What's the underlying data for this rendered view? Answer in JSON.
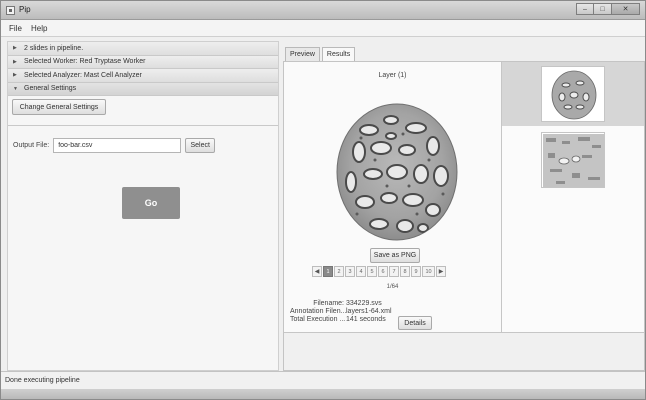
{
  "window": {
    "title": "Pip"
  },
  "menu": {
    "items": [
      "File",
      "Help"
    ]
  },
  "sidebar": {
    "sections": [
      {
        "label": "2 slides in pipeline.",
        "state": "collapsed"
      },
      {
        "label": "Selected Worker: Red Tryptase Worker",
        "state": "collapsed"
      },
      {
        "label": "Selected Analyzer: Mast Cell Analyzer",
        "state": "collapsed"
      },
      {
        "label": "General Settings",
        "state": "expanded"
      }
    ],
    "change_settings_label": "Change General Settings",
    "output_file_label": "Output File:",
    "output_file_value": "foo-bar.csv",
    "select_label": "Select",
    "go_label": "Go"
  },
  "tabs": [
    {
      "label": "Preview",
      "active": false
    },
    {
      "label": "Results",
      "active": true
    }
  ],
  "results": {
    "layer_title": "Layer (1)",
    "save_label": "Save as PNG",
    "pager": {
      "prev": "◀",
      "next": "▶",
      "pages": [
        "1",
        "2",
        "3",
        "4",
        "5",
        "6",
        "7",
        "8",
        "9",
        "10"
      ],
      "active_page": "1",
      "count": "1/64"
    },
    "info": {
      "filename_label": "Filename:",
      "filename_value": "334229.svs",
      "annotation_label": "Annotation Filen...",
      "annotation_value": "layers1-64.xml",
      "time_label": "Total Execution ...",
      "time_value": "141 seconds"
    },
    "details_label": "Details"
  },
  "status": {
    "text": "Done executing pipeline"
  },
  "colors": {
    "go_button": "#8f8f8f",
    "active_page": "#8a8a8a",
    "selected_thumb": "#d6d6d6"
  }
}
